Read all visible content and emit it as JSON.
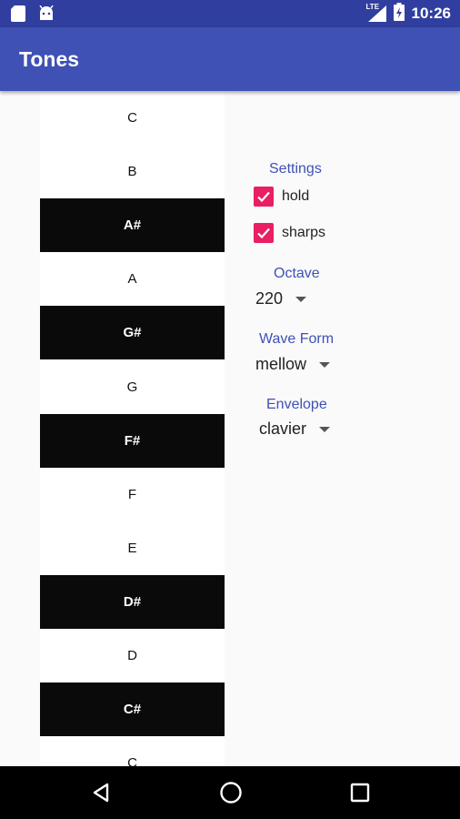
{
  "status_bar": {
    "time": "10:26",
    "network": "LTE"
  },
  "app_bar": {
    "title": "Tones"
  },
  "keys": [
    {
      "label": "C",
      "type": "white"
    },
    {
      "label": "B",
      "type": "white"
    },
    {
      "label": "A#",
      "type": "black"
    },
    {
      "label": "A",
      "type": "white"
    },
    {
      "label": "G#",
      "type": "black"
    },
    {
      "label": "G",
      "type": "white"
    },
    {
      "label": "F#",
      "type": "black"
    },
    {
      "label": "F",
      "type": "white"
    },
    {
      "label": "E",
      "type": "white"
    },
    {
      "label": "D#",
      "type": "black"
    },
    {
      "label": "D",
      "type": "white"
    },
    {
      "label": "C#",
      "type": "black"
    },
    {
      "label": "C",
      "type": "white"
    }
  ],
  "settings": {
    "label": "Settings",
    "hold": {
      "label": "hold",
      "checked": true
    },
    "sharps": {
      "label": "sharps",
      "checked": true
    }
  },
  "octave": {
    "label": "Octave",
    "value": "220"
  },
  "wave_form": {
    "label": "Wave Form",
    "value": "mellow"
  },
  "envelope": {
    "label": "Envelope",
    "value": "clavier"
  },
  "colors": {
    "primary": "#3f51b5",
    "primary_dark": "#303f9f",
    "accent": "#e91e63"
  }
}
